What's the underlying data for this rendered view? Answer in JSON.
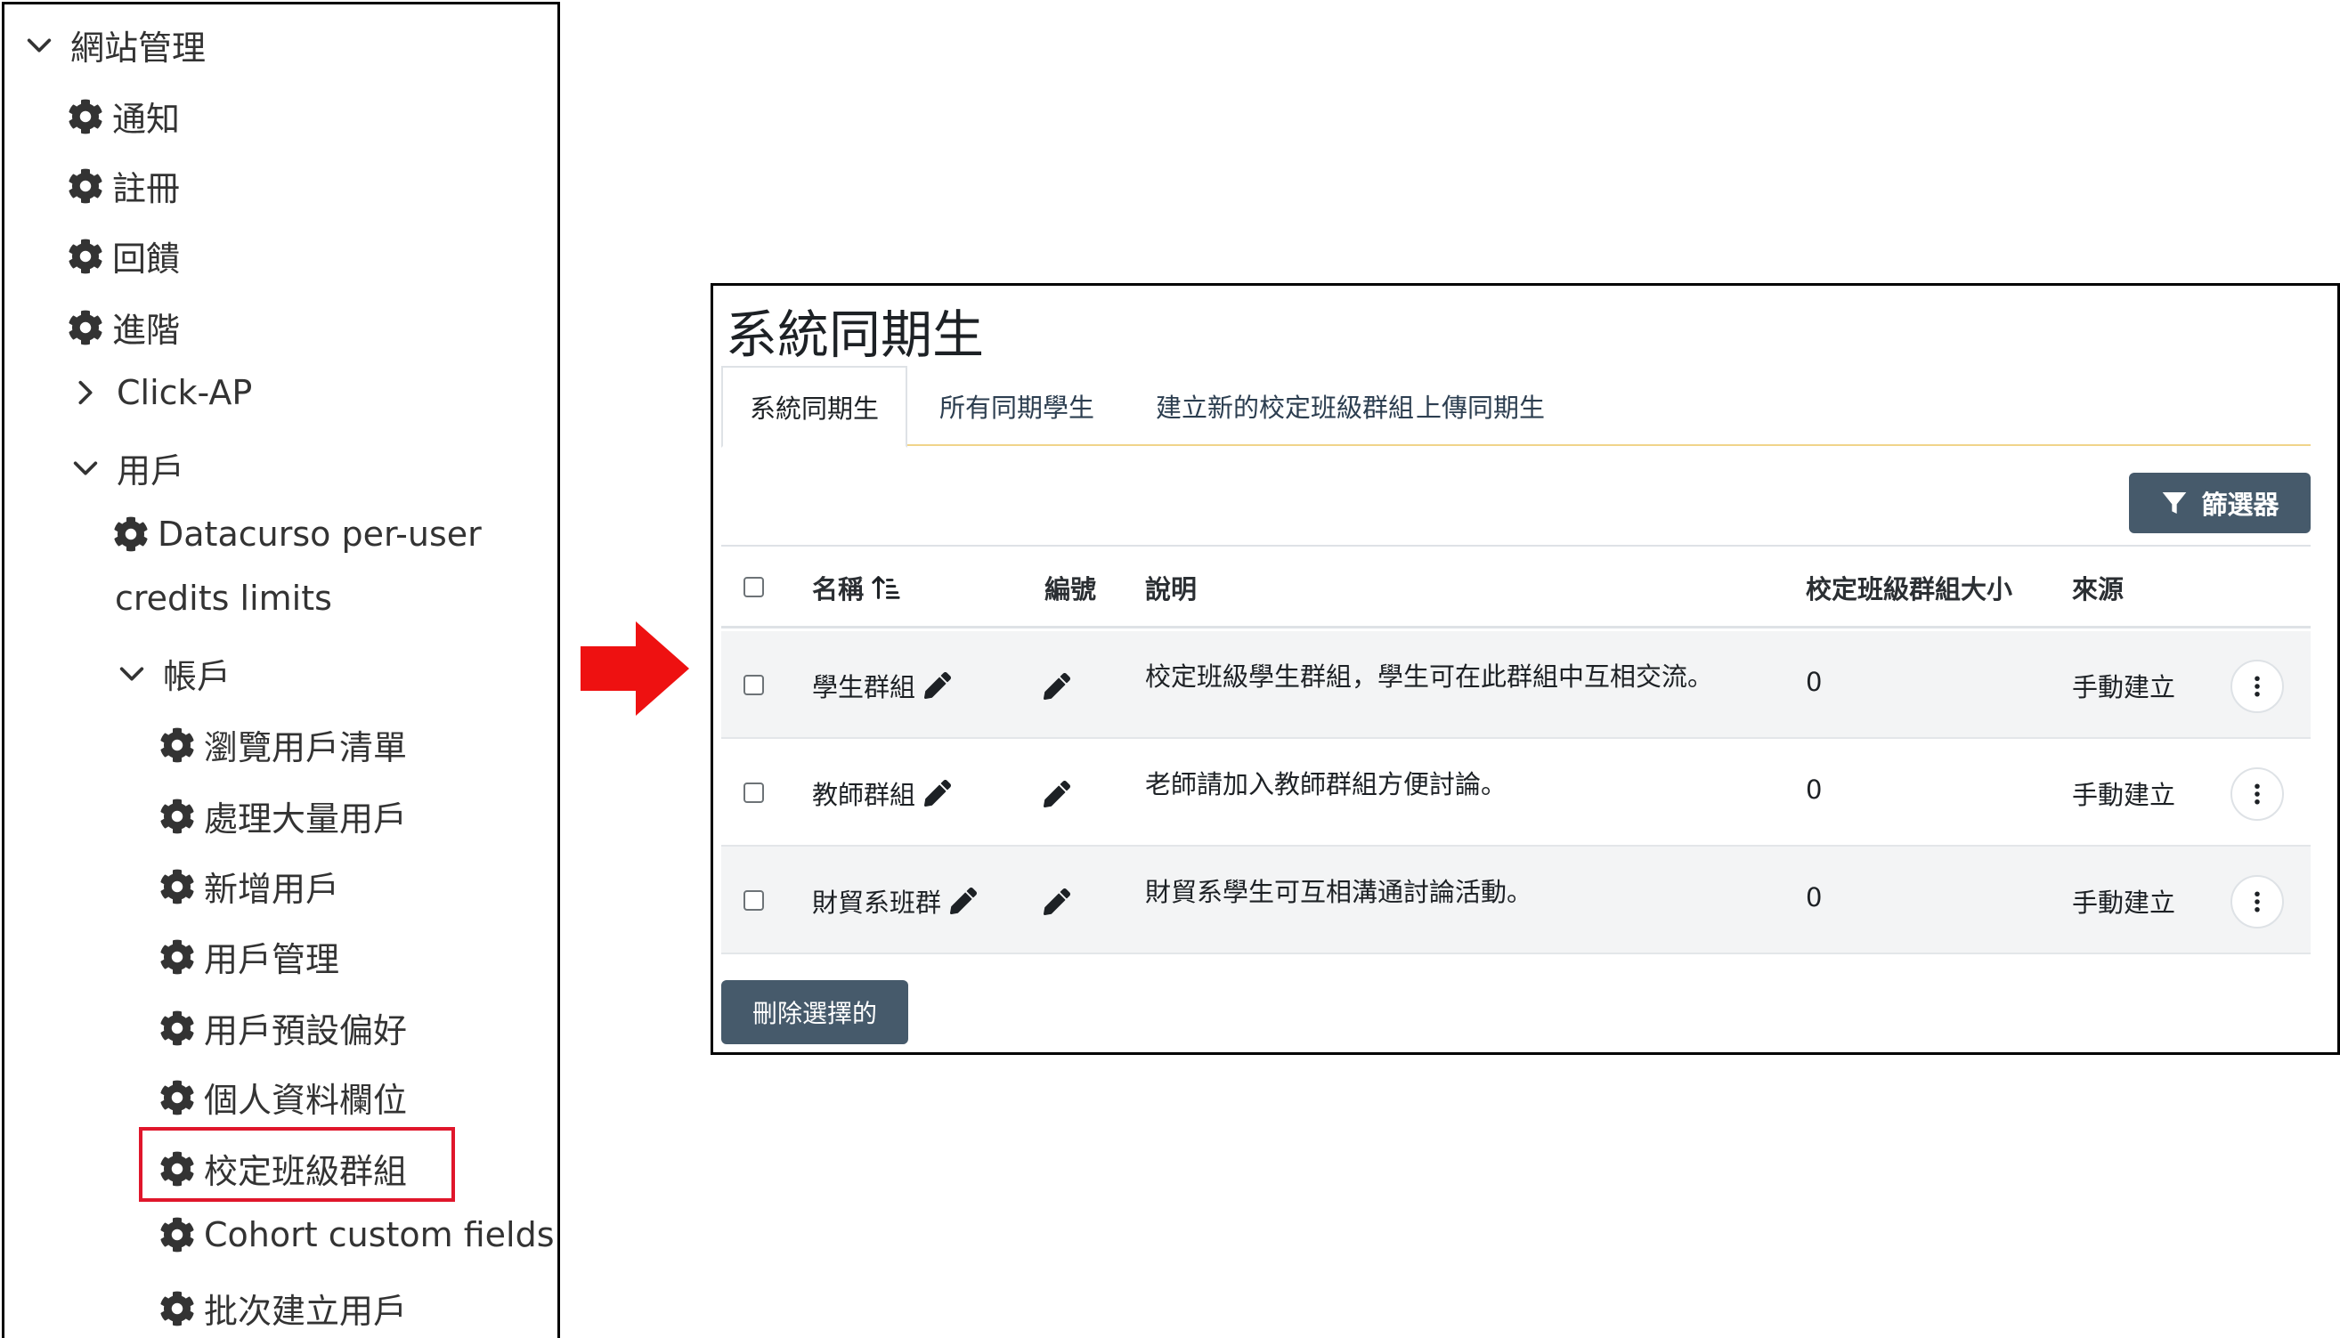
{
  "nav": {
    "site_admin": "網站管理",
    "notifications": "通知",
    "registration": "註冊",
    "feedback": "回饋",
    "advanced": "進階",
    "click_ap": "Click-AP",
    "users": "用戶",
    "datacurso_line1": "Datacurso per-user",
    "datacurso_line2": "credits limits",
    "accounts": "帳戶",
    "browse_users": "瀏覽用戶清單",
    "bulk_users": "處理大量用戶",
    "add_user": "新增用戶",
    "user_management": "用戶管理",
    "user_default_prefs": "用戶預設偏好",
    "profile_fields": "個人資料欄位",
    "cohorts": "校定班級群組",
    "cohort_custom_fields": "Cohort custom fields",
    "upload_users": "批次建立用戶"
  },
  "main": {
    "title": "系統同期生",
    "tabs": [
      "系統同期生",
      "所有同期學生",
      "建立新的校定班級群組",
      "上傳同期生"
    ],
    "filter_label": "篩選器",
    "columns": {
      "name": "名稱",
      "idnumber": "編號",
      "description": "說明",
      "size": "校定班級群組大小",
      "source": "來源"
    },
    "rows": [
      {
        "name": "學生群組",
        "description": "校定班級學生群組，學生可在此群組中互相交流。",
        "size": "0",
        "source": "手動建立"
      },
      {
        "name": "教師群組",
        "description": "老師請加入教師群組方便討論。",
        "size": "0",
        "source": "手動建立"
      },
      {
        "name": "財貿系班群",
        "description": "財貿系學生可互相溝通討論活動。",
        "size": "0",
        "source": "手動建立"
      }
    ],
    "delete_selected": "刪除選擇的"
  },
  "colors": {
    "button_bg": "#465a6b",
    "highlight": "#e0162b",
    "arrow": "#ee1111",
    "tab_underline": "#f0d48a"
  }
}
